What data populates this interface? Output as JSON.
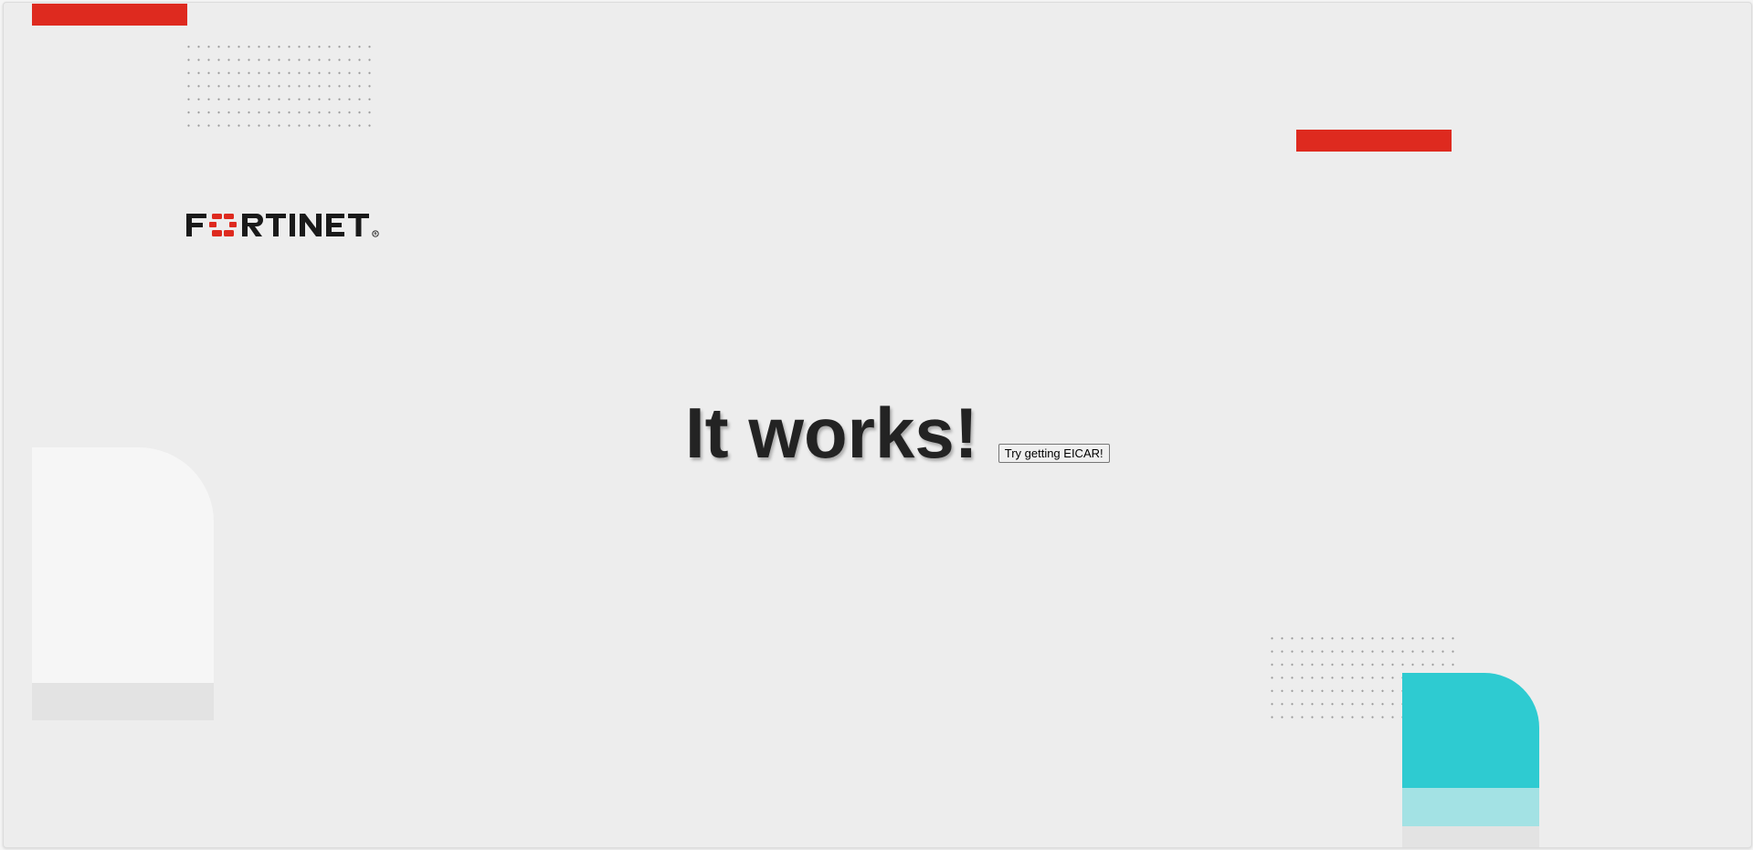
{
  "page": {
    "logo_text": "FORTINET",
    "heading": "It works!",
    "eicar_button_label": "Try getting EICAR!"
  },
  "colors": {
    "brand_red": "#de2a1f",
    "accent_teal": "#2ecbd1",
    "teal_light": "#a3e2e4",
    "background": "#ededed",
    "heading_text": "#232323"
  },
  "icons": {
    "logo": "fortinet-logo"
  }
}
